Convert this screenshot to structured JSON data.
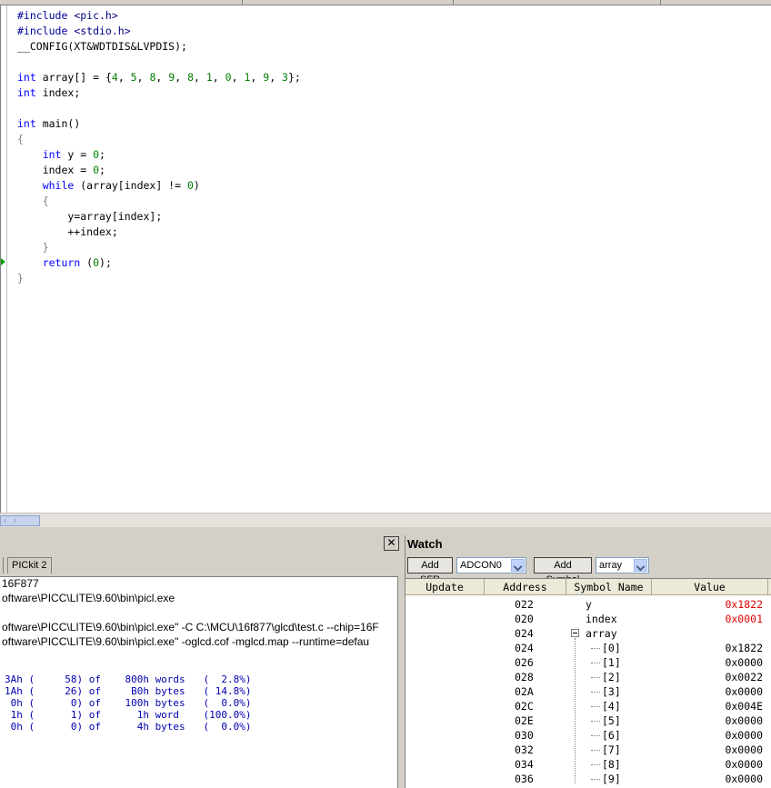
{
  "editor": {
    "lines": [
      [
        {
          "t": "#include ",
          "c": "pp"
        },
        {
          "t": "<pic.h>",
          "c": "hdr"
        }
      ],
      [
        {
          "t": "#include ",
          "c": "pp"
        },
        {
          "t": "<stdio.h>",
          "c": "hdr"
        }
      ],
      [
        {
          "t": "__CONFIG(XT&WDTDIS&LVPDIS);",
          "c": ""
        }
      ],
      [],
      [
        {
          "t": "int",
          "c": "kw"
        },
        {
          "t": " array[] = {",
          "c": ""
        },
        {
          "t": "4",
          "c": "num"
        },
        {
          "t": ", ",
          "c": ""
        },
        {
          "t": "5",
          "c": "num"
        },
        {
          "t": ", ",
          "c": ""
        },
        {
          "t": "8",
          "c": "num"
        },
        {
          "t": ", ",
          "c": ""
        },
        {
          "t": "9",
          "c": "num"
        },
        {
          "t": ", ",
          "c": ""
        },
        {
          "t": "8",
          "c": "num"
        },
        {
          "t": ", ",
          "c": ""
        },
        {
          "t": "1",
          "c": "num"
        },
        {
          "t": ", ",
          "c": ""
        },
        {
          "t": "0",
          "c": "num"
        },
        {
          "t": ", ",
          "c": ""
        },
        {
          "t": "1",
          "c": "num"
        },
        {
          "t": ", ",
          "c": ""
        },
        {
          "t": "9",
          "c": "num"
        },
        {
          "t": ", ",
          "c": ""
        },
        {
          "t": "3",
          "c": "num"
        },
        {
          "t": "};",
          "c": ""
        }
      ],
      [
        {
          "t": "int",
          "c": "kw"
        },
        {
          "t": " index;",
          "c": ""
        }
      ],
      [],
      [
        {
          "t": "int",
          "c": "kw"
        },
        {
          "t": " main()",
          "c": ""
        }
      ],
      [
        {
          "t": "{",
          "c": "punc"
        }
      ],
      [
        {
          "t": "    ",
          "c": ""
        },
        {
          "t": "int",
          "c": "kw"
        },
        {
          "t": " y = ",
          "c": ""
        },
        {
          "t": "0",
          "c": "num"
        },
        {
          "t": ";",
          "c": ""
        }
      ],
      [
        {
          "t": "    index = ",
          "c": ""
        },
        {
          "t": "0",
          "c": "num"
        },
        {
          "t": ";",
          "c": ""
        }
      ],
      [
        {
          "t": "    ",
          "c": ""
        },
        {
          "t": "while",
          "c": "kw"
        },
        {
          "t": " (array[index] != ",
          "c": ""
        },
        {
          "t": "0",
          "c": "num"
        },
        {
          "t": ")",
          "c": ""
        }
      ],
      [
        {
          "t": "    {",
          "c": "punc"
        }
      ],
      [
        {
          "t": "        y=array[index];",
          "c": ""
        }
      ],
      [
        {
          "t": "        ++index;",
          "c": ""
        }
      ],
      [
        {
          "t": "    }",
          "c": "punc"
        }
      ],
      [
        {
          "t": "    ",
          "c": ""
        },
        {
          "t": "return",
          "c": "kw"
        },
        {
          "t": " (",
          "c": ""
        },
        {
          "t": "0",
          "c": "num"
        },
        {
          "t": ");",
          "c": ""
        }
      ],
      [
        {
          "t": "}",
          "c": "punc"
        }
      ]
    ]
  },
  "output": {
    "close_label": "✕",
    "tab_label": "PICkit 2",
    "text_lines": [
      "16F877",
      "oftware\\PICC\\LITE\\9.60\\bin\\picl.exe",
      "",
      "oftware\\PICC\\LITE\\9.60\\bin\\picl.exe\" -C C:\\MCU\\16f877\\glcd\\test.c --chip=16F",
      "oftware\\PICC\\LITE\\9.60\\bin\\picl.exe\" -oglcd.cof -mglcd.map --runtime=defau"
    ],
    "memory_lines": [
      "3Ah (     58) of    800h words   (  2.8%)",
      "1Ah (     26) of     B0h bytes   ( 14.8%)",
      " 0h (      0) of    100h bytes   (  0.0%)",
      " 1h (      1) of      1h word    (100.0%)",
      " 0h (      0) of      4h bytes   (  0.0%)"
    ]
  },
  "watch": {
    "title": "Watch",
    "add_sfr_label": "Add SFR",
    "sfr_select": "ADCON0",
    "add_symbol_label": "Add Symbol",
    "symbol_select": "array",
    "columns": [
      "Update",
      "Address",
      "Symbol Name",
      "Value"
    ],
    "rows": [
      {
        "address": "022",
        "symbol": "y",
        "value": "0x1822",
        "changed": true,
        "level": 0
      },
      {
        "address": "020",
        "symbol": "index",
        "value": "0x0001",
        "changed": true,
        "level": 0
      },
      {
        "address": "024",
        "symbol": "array",
        "value": "",
        "changed": false,
        "level": 0,
        "expanded": true
      },
      {
        "address": "024",
        "symbol": "[0]",
        "value": "0x1822",
        "changed": false,
        "level": 1
      },
      {
        "address": "026",
        "symbol": "[1]",
        "value": "0x0000",
        "changed": false,
        "level": 1
      },
      {
        "address": "028",
        "symbol": "[2]",
        "value": "0x0022",
        "changed": false,
        "level": 1
      },
      {
        "address": "02A",
        "symbol": "[3]",
        "value": "0x0000",
        "changed": false,
        "level": 1
      },
      {
        "address": "02C",
        "symbol": "[4]",
        "value": "0x004E",
        "changed": false,
        "level": 1
      },
      {
        "address": "02E",
        "symbol": "[5]",
        "value": "0x0000",
        "changed": false,
        "level": 1
      },
      {
        "address": "030",
        "symbol": "[6]",
        "value": "0x0000",
        "changed": false,
        "level": 1
      },
      {
        "address": "032",
        "symbol": "[7]",
        "value": "0x0000",
        "changed": false,
        "level": 1
      },
      {
        "address": "034",
        "symbol": "[8]",
        "value": "0x0000",
        "changed": false,
        "level": 1
      },
      {
        "address": "036",
        "symbol": "[9]",
        "value": "0x0000",
        "changed": false,
        "level": 1
      }
    ]
  }
}
